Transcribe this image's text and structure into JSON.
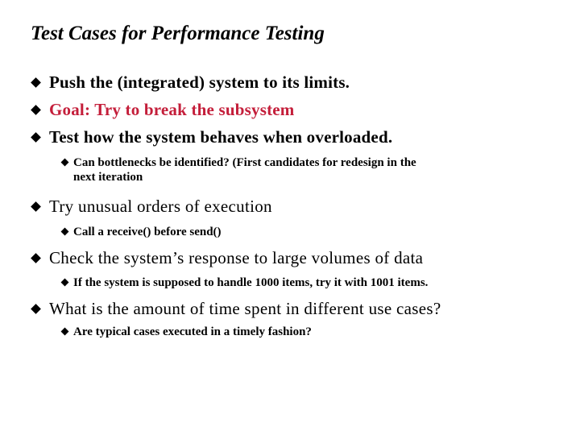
{
  "slide": {
    "title": "Test Cases for Performance Testing",
    "accent_color": "#c41e3a",
    "bullets": [
      {
        "text": "Push the (integrated) system to its limits.",
        "bullet_icon": "diamond-bullet"
      },
      {
        "text": "Goal: Try to break the subsystem",
        "bullet_icon": "diamond-bullet",
        "highlight": true
      },
      {
        "text": "Test how the system behaves when overloaded.",
        "bullet_icon": "diamond-bullet",
        "sub": [
          {
            "line1": "Can bottlenecks be identified?  (First candidates for  redesign in the",
            "line2": "next iteration"
          }
        ]
      },
      {
        "text": "Try unusual orders of execution",
        "bullet_icon": "diamond-bullet",
        "sub": [
          {
            "line1": "Call a receive()  before send()"
          }
        ]
      },
      {
        "text": "Check the system’s response to large volumes of data",
        "bullet_icon": "diamond-bullet",
        "sub": [
          {
            "line1": "If the system is supposed to handle 1000 items, try it with 1001 items."
          }
        ]
      },
      {
        "text": "What is the amount of time spent in different use cases?",
        "bullet_icon": "diamond-bullet",
        "sub": [
          {
            "line1": "Are typical cases executed  in a timely fashion?"
          }
        ]
      }
    ]
  }
}
